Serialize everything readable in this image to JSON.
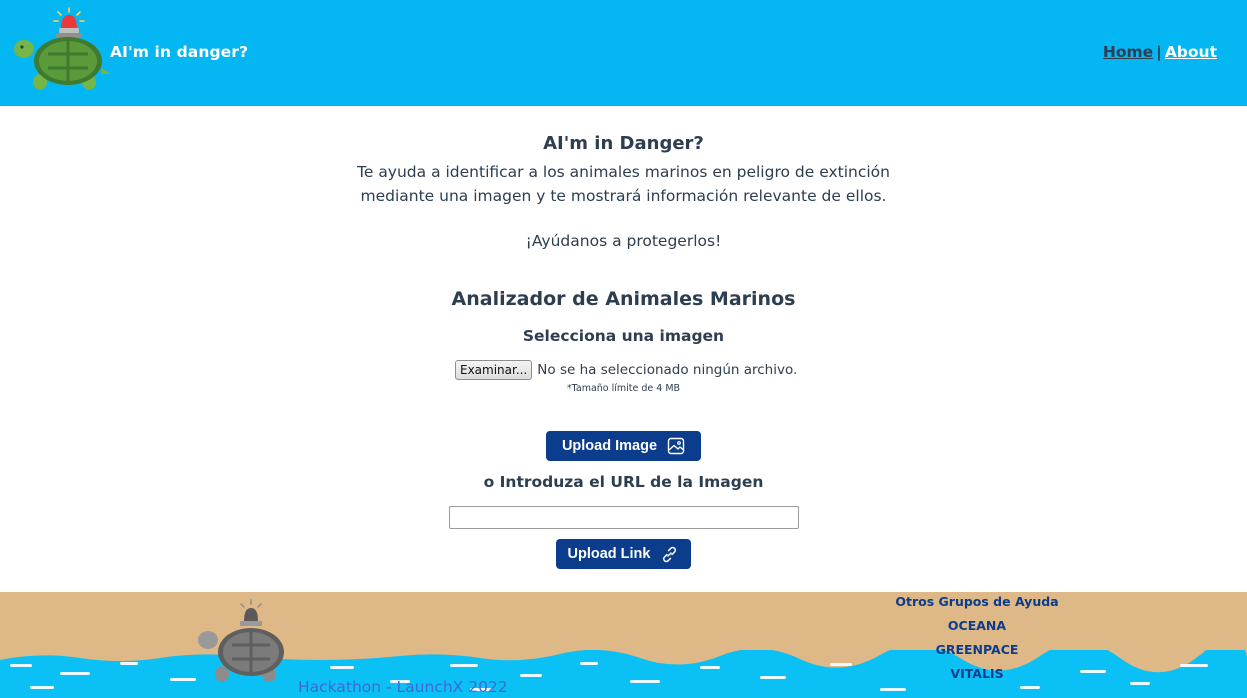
{
  "header": {
    "brand": "AI'm in danger?",
    "nav": {
      "home": "Home",
      "separator": "|",
      "about": "About"
    },
    "logo_icon": "turtle-with-siren-icon"
  },
  "main": {
    "title": "AI'm in Danger?",
    "description_line1": "Te ayuda a identificar a los animales marinos en peligro de extinción",
    "description_line2": "mediante una imagen y te mostrará información relevante de ellos.",
    "cta": "¡Ayúdanos a protegerlos!",
    "section_title": "Analizador de Animales Marinos",
    "select_label": "Selecciona una imagen",
    "file_button": "Examinar...",
    "file_status": "No se ha seleccionado ningún archivo.",
    "size_note": "*Tamaño límite de 4 MB",
    "upload_image_label": "Upload Image",
    "upload_image_icon": "image-icon",
    "url_label": "o Introduza el URL de la Imagen",
    "url_value": "",
    "upload_link_label": "Upload Link",
    "upload_link_icon": "link-icon"
  },
  "footer": {
    "credit": "Hackathon - LaunchX 2022",
    "links_title": "Otros Grupos de Ayuda",
    "links": [
      "OCEANA",
      "GREENPACE",
      "VITALIS"
    ],
    "turtle_icon": "gray-turtle-with-siren-icon"
  },
  "colors": {
    "header_bg": "#04b6f2",
    "button_bg": "#0b3d8c",
    "footer_sand": "#dfb887",
    "footer_water": "#0bc0f5",
    "text": "#2c3e50"
  }
}
